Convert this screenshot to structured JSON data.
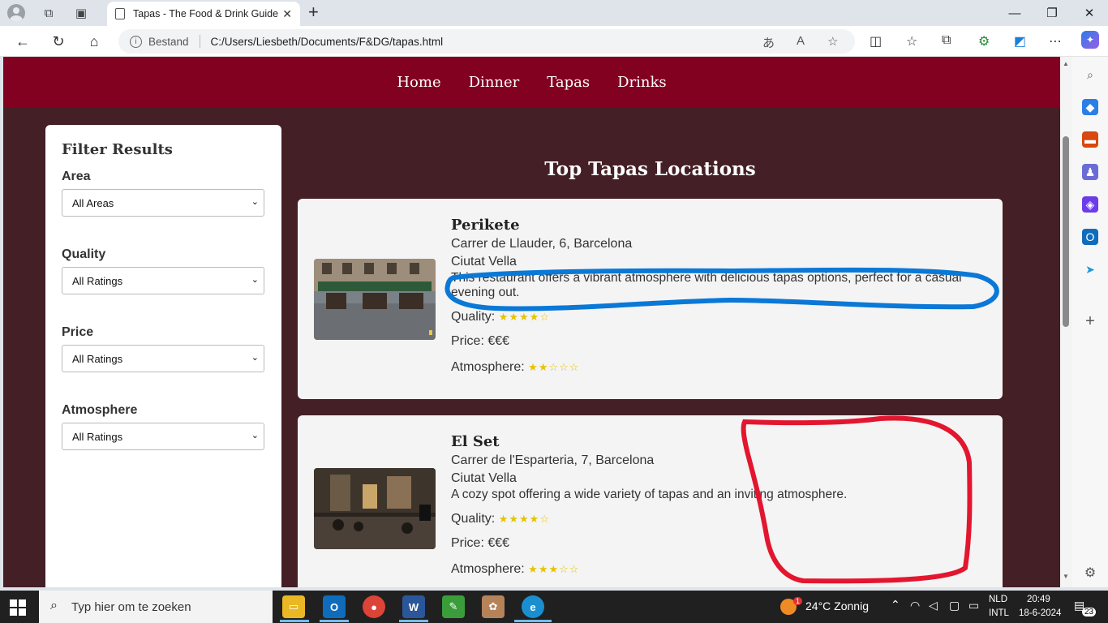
{
  "browser": {
    "tab_title": "Tapas - The Food & Drink Guide",
    "tab_close": "✕",
    "address_label": "Bestand",
    "address_url": "C:/Users/Liesbeth/Documents/F&DG/tapas.html"
  },
  "site": {
    "nav": [
      "Home",
      "Dinner",
      "Tapas",
      "Drinks"
    ],
    "heading": "Top Tapas Locations"
  },
  "filter": {
    "title": "Filter Results",
    "groups": [
      {
        "label": "Area",
        "value": "All Areas"
      },
      {
        "label": "Quality",
        "value": "All Ratings"
      },
      {
        "label": "Price",
        "value": "All Ratings"
      },
      {
        "label": "Atmosphere",
        "value": "All Ratings"
      }
    ]
  },
  "cards": [
    {
      "name": "Perikete",
      "address": "Carrer de Llauder, 6, Barcelona",
      "district": "Ciutat Vella",
      "description": "This restaurant offers a vibrant atmosphere with delicious tapas options, perfect for a casual evening out.",
      "quality_label": "Quality:",
      "quality_stars": "★★★★☆",
      "quality_rating": 4,
      "price_label": "Price:",
      "price": "€€€",
      "atmosphere_label": "Atmosphere:",
      "atmosphere_stars": "★★☆☆☆",
      "atmosphere_rating": 2
    },
    {
      "name": "El Set",
      "address": "Carrer de l'Esparteria, 7, Barcelona",
      "district": "Ciutat Vella",
      "description": "A cozy spot offering a wide variety of tapas and an inviting atmosphere.",
      "quality_label": "Quality:",
      "quality_stars": "★★★★☆",
      "quality_rating": 4,
      "price_label": "Price:",
      "price": "€€€",
      "atmosphere_label": "Atmosphere:",
      "atmosphere_stars": "★★★☆☆",
      "atmosphere_rating": 3
    }
  ],
  "annotations": {
    "blue_circle_color": "#0a78d7",
    "red_circle_color": "#e3162f"
  },
  "taskbar": {
    "search_placeholder": "Typ hier om te zoeken",
    "weather": "24°C  Zonnig",
    "weather_badge": "1",
    "lang_top": "NLD",
    "lang_bottom": "INTL",
    "time": "20:49",
    "date": "18-6-2024",
    "notifications": "23"
  },
  "colors": {
    "site_nav_bg": "#820020",
    "page_bg": "#441f25",
    "star": "#e6c300"
  }
}
